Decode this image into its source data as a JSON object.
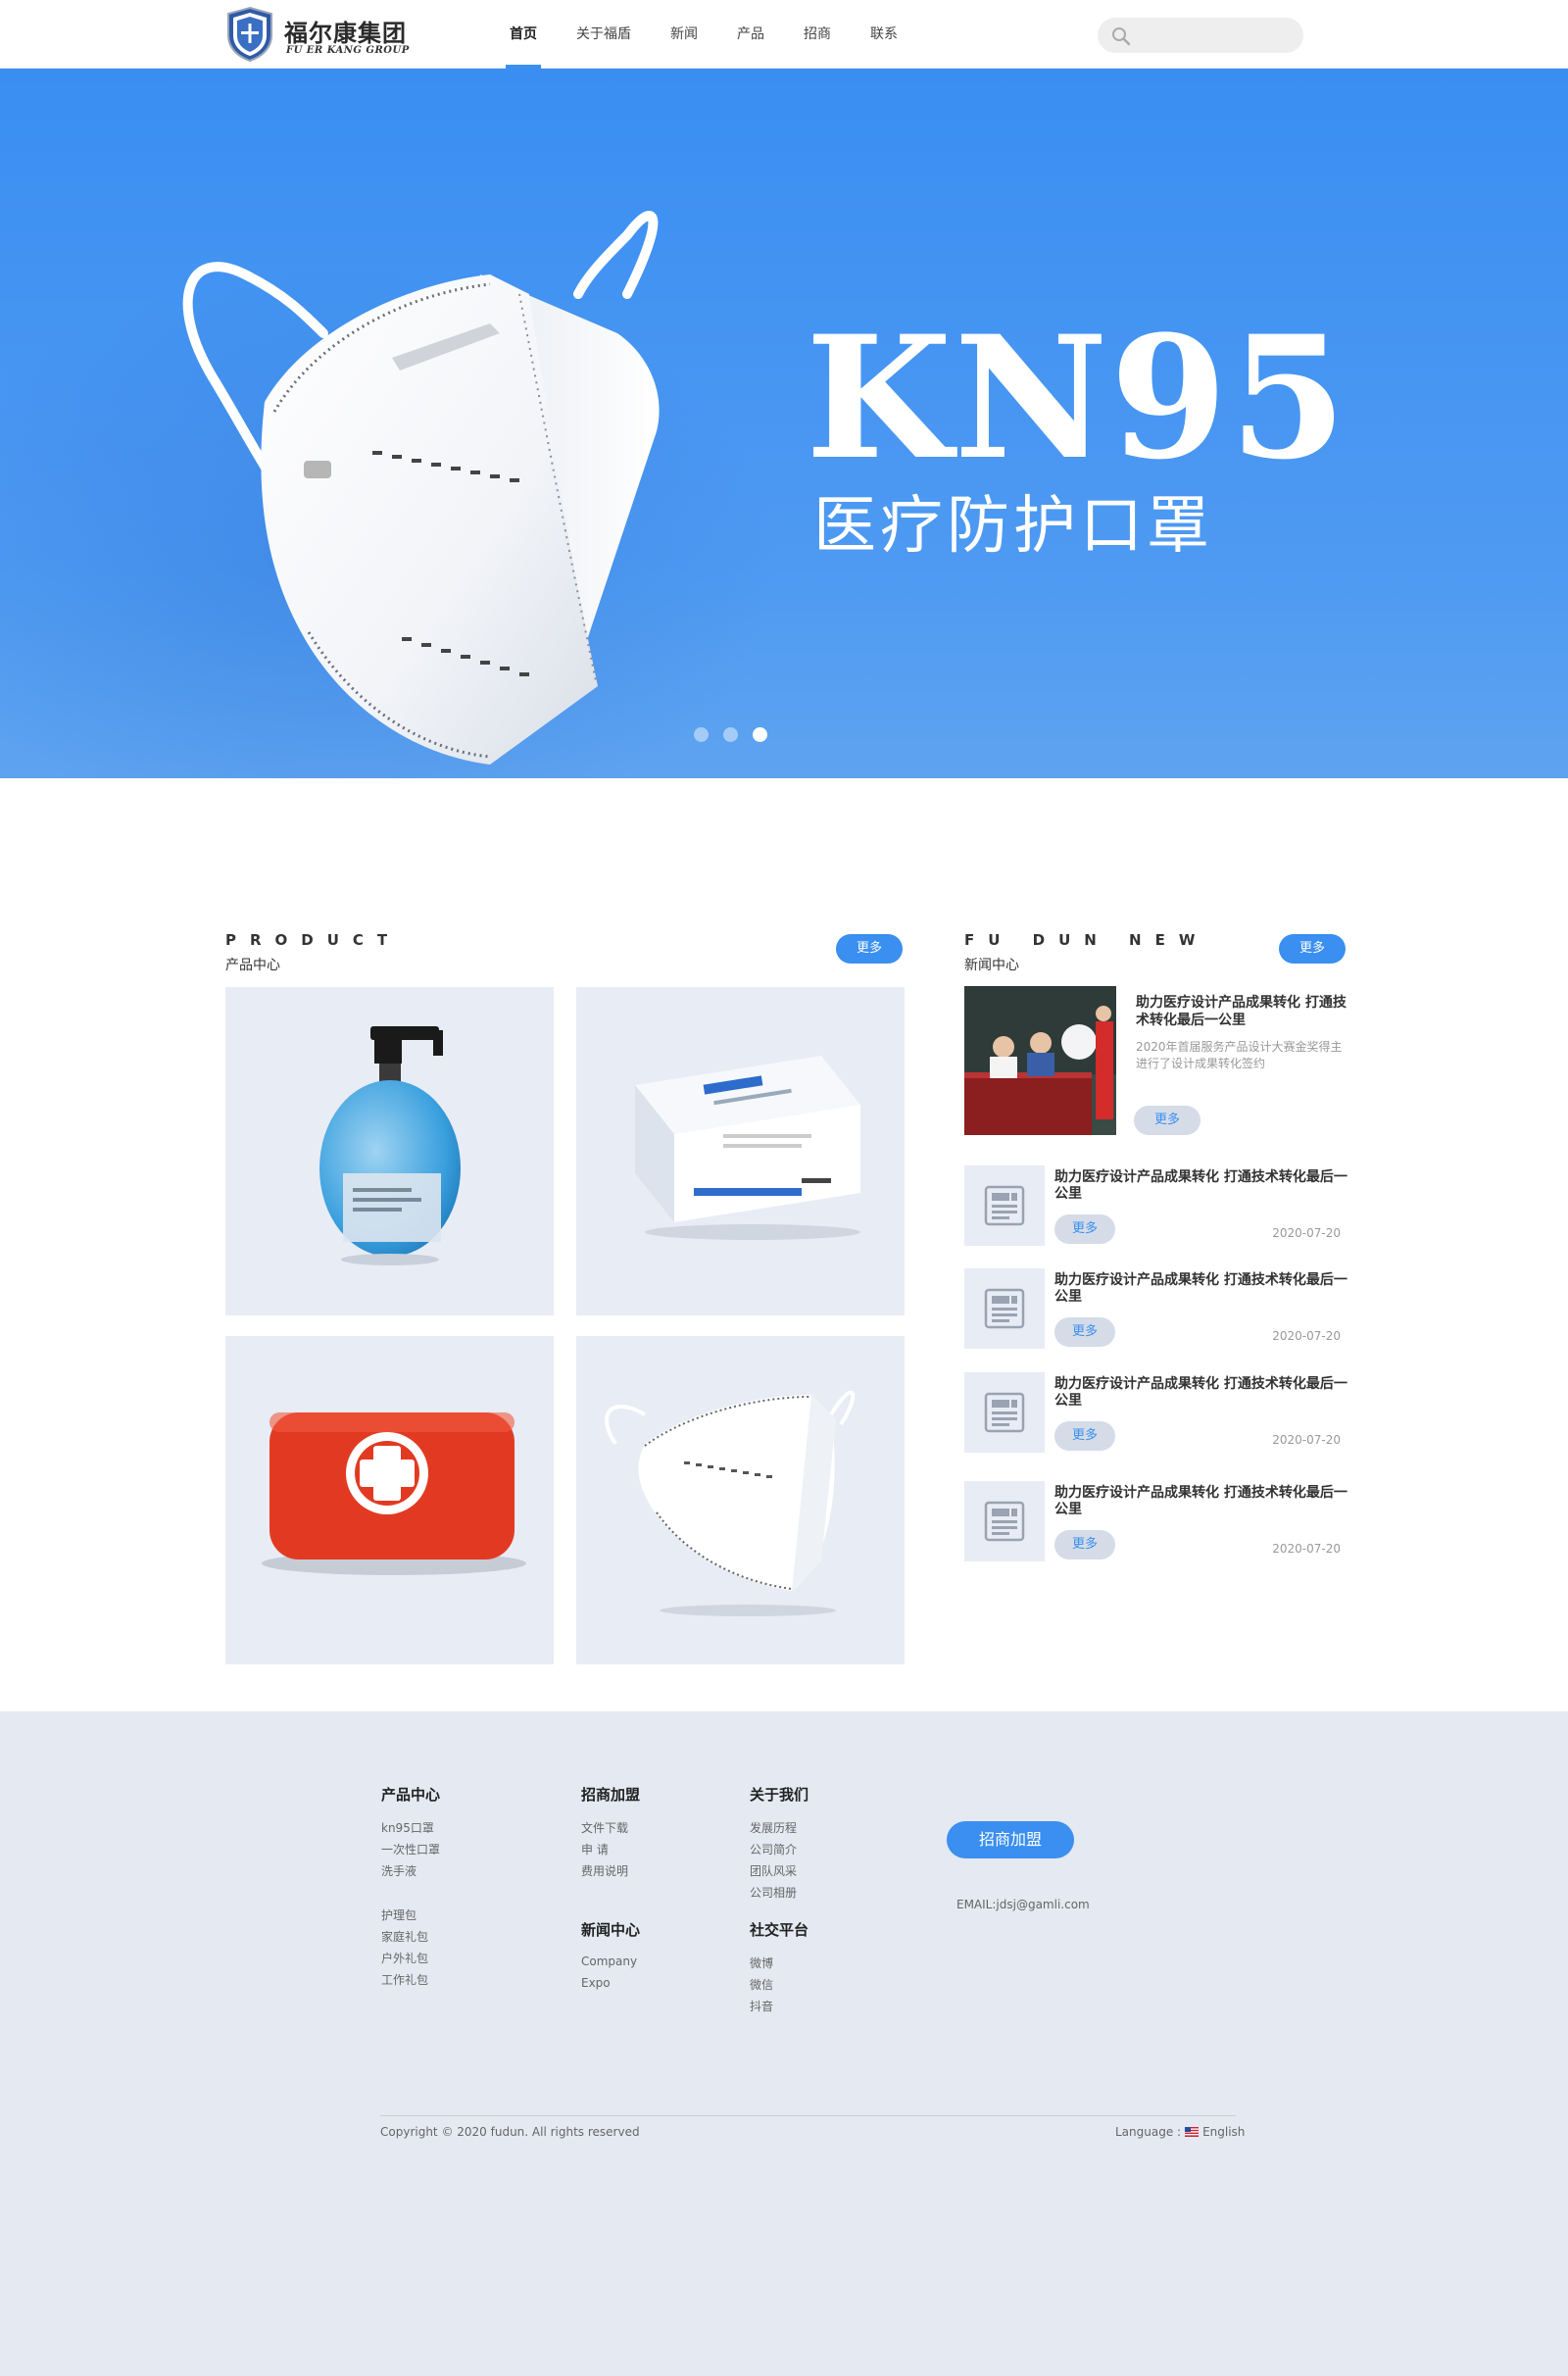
{
  "header": {
    "logo_cn": "福尔康集团",
    "logo_en": "FU ER KANG GROUP",
    "nav": [
      "首页",
      "关于福盾",
      "新闻",
      "产品",
      "招商",
      "联系"
    ],
    "active_nav": "首页",
    "search_placeholder": ""
  },
  "hero": {
    "title": "KN95",
    "subtitle": "医疗防护口罩",
    "slides_count": 3,
    "active_slide": 3
  },
  "product": {
    "section_en": "PRODUCT",
    "section_cn": "产品中心",
    "more": "更多",
    "items": [
      {
        "image": "hand-sanitizer-bottle"
      },
      {
        "image": "medical-mask-box"
      },
      {
        "image": "first-aid-kit"
      },
      {
        "image": "kn95-mask"
      }
    ]
  },
  "news": {
    "section_en": "FU DUN NEW",
    "section_cn": "新闻中心",
    "more": "更多",
    "feature": {
      "title": "助力医疗设计产品成果转化 打通技术转化最后一公里",
      "desc": "2020年首届服务产品设计大赛金奖得主进行了设计成果转化签约",
      "button": "更多"
    },
    "items": [
      {
        "title": "助力医疗设计产品成果转化 打通技术转化最后一公里",
        "button": "更多",
        "date": "2020-07-20"
      },
      {
        "title": "助力医疗设计产品成果转化 打通技术转化最后一公里",
        "button": "更多",
        "date": "2020-07-20"
      },
      {
        "title": "助力医疗设计产品成果转化 打通技术转化最后一公里",
        "button": "更多",
        "date": "2020-07-20"
      },
      {
        "title": "助力医疗设计产品成果转化 打通技术转化最后一公里",
        "button": "更多",
        "date": "2020-07-20"
      }
    ]
  },
  "footer": {
    "col1": {
      "title": "产品中心",
      "links": [
        "kn95口罩",
        "一次性口罩",
        "洗手液",
        "护理包",
        "家庭礼包",
        "户外礼包",
        "工作礼包"
      ]
    },
    "col2": {
      "title": "招商加盟",
      "links": [
        "文件下载",
        "申 请",
        "费用说明"
      ]
    },
    "col2b": {
      "title": "新闻中心",
      "links": [
        "Company",
        "Expo"
      ]
    },
    "col3": {
      "title": "关于我们",
      "links": [
        "发展历程",
        "公司简介",
        "团队风采",
        "公司相册"
      ]
    },
    "col3b": {
      "title": "社交平台",
      "links": [
        "微博",
        "微信",
        "抖音"
      ]
    },
    "join_button": "招商加盟",
    "email": "EMAIL:jdsj@gamli.com",
    "copyright": "Copyright © 2020 fudun. All rights reserved",
    "language_label": "Language :",
    "language": "English"
  },
  "colors": {
    "accent": "#3a8ff0",
    "hero_bg": "#3a8ef2",
    "card_bg": "#e8ecf5",
    "footer_bg": "#e4e9f2"
  }
}
